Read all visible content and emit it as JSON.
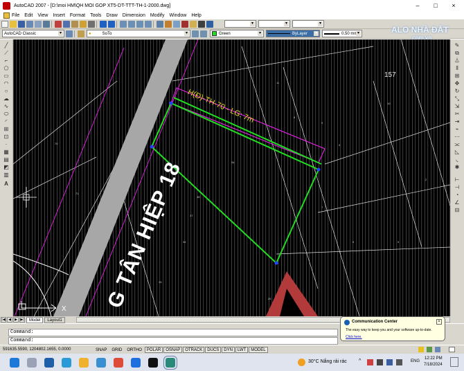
{
  "window": {
    "title": "AutoCAD 2007 - [D:\\moi HM\\QH MOI GOP XT5-DT-TTT-TH-1-2000.dwg]",
    "controls": {
      "minimize": "–",
      "maximize": "□",
      "close": "×"
    }
  },
  "menu": [
    "File",
    "Edit",
    "View",
    "Insert",
    "Format",
    "Tools",
    "Draw",
    "Dimension",
    "Modify",
    "Window",
    "Help"
  ],
  "toolbar": {
    "workspace": "AutoCAD Classic",
    "layer": "SoTo",
    "color": "Green",
    "linetype": "ByLayer",
    "lineweight": "0.50 mm"
  },
  "watermark": {
    "line1": "ALO NHÀ ĐẤT",
    "line2": ".com.vn"
  },
  "drawing": {
    "road_name": "TÂN HIỆP 18",
    "road_prefix": "G",
    "label_lot": "H(Đ)-TH-70 - LG: 7m",
    "label_157": "157",
    "small_labels": [
      "70",
      "71",
      "21",
      "38",
      "37",
      "36",
      "35",
      "34",
      "7",
      "6",
      "5",
      "3",
      "9",
      "8",
      "10",
      "11",
      "26",
      "2"
    ]
  },
  "tabs": {
    "model": "Model",
    "layout1": "Layout1",
    "nav": [
      "|◀",
      "◀",
      "▶",
      "▶|"
    ]
  },
  "command_lines": [
    "Command:",
    "Command:"
  ],
  "status": {
    "coords": "591635.5590, 1204802.1655, 0.0000",
    "toggles": [
      "SNAP",
      "GRID",
      "ORTHO",
      "POLAR",
      "OSNAP",
      "OTRACK",
      "DUCS",
      "DYN",
      "LWT",
      "MODEL"
    ]
  },
  "notification": {
    "title": "Communication Center",
    "body": "The easy way to keep you and your software up-to-date.",
    "link": "Click here."
  },
  "tray": {
    "weather": "30°C  Nắng rải rác",
    "lang": "ENG",
    "time": "12:22 PM",
    "date": "7/18/2024"
  },
  "colors": {
    "accent": "#3a6ea5",
    "lot_outline": "#22dd22",
    "setback": "#dd22dd",
    "road": "#a7a7a7"
  }
}
